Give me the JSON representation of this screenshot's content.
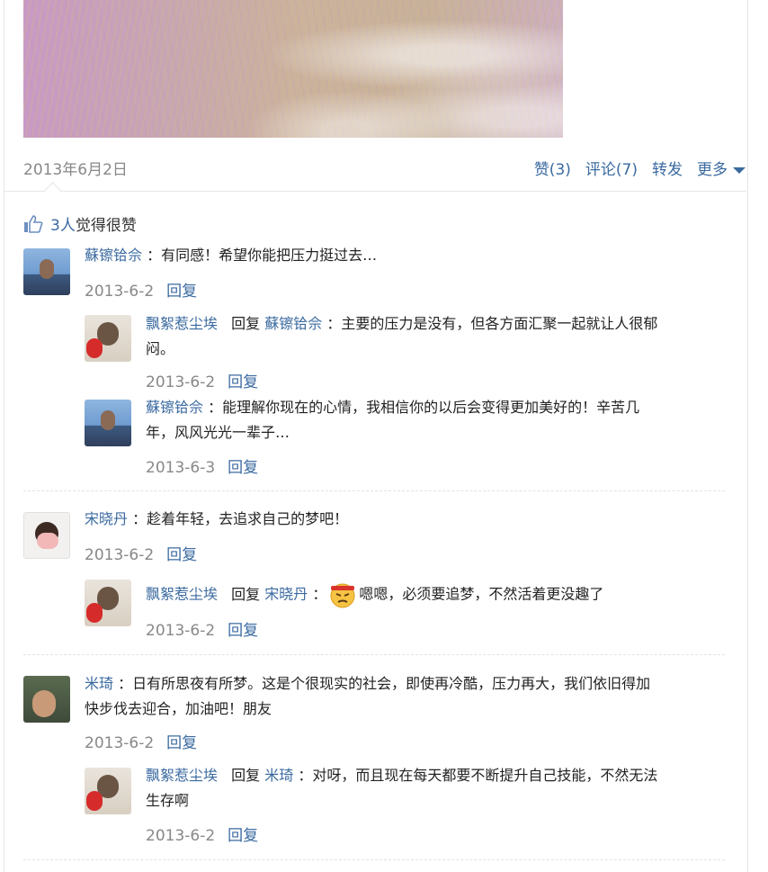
{
  "post": {
    "date": "2013年6月2日",
    "actions": {
      "like": "赞(3)",
      "comment": "评论(7)",
      "forward": "转发",
      "more": "更多"
    }
  },
  "likes": {
    "count": "3人",
    "suffix": "觉得很赞"
  },
  "reply_label": "回复",
  "comments": [
    {
      "author": "蘇镲铪佘",
      "text": "：有同感！希望你能把压力挺过去…",
      "time": "2013-6-2",
      "replies": [
        {
          "author": "飘絮惹尘埃",
          "prefix": "回复",
          "to": "蘇镲铪佘",
          "text": "：主要的压力是没有，但各方面汇聚一起就让人很郁",
          "text2": "闷。",
          "time": "2013-6-2"
        },
        {
          "author": "蘇镲铪佘",
          "text": "：能理解你现在的心情，我相信你的以后会变得更加美好的！辛苦几",
          "text2": "年，风风光光一辈子…",
          "time": "2013-6-3"
        }
      ]
    },
    {
      "author": "宋晓丹",
      "text": "：趁着年轻，去追求自己的梦吧！",
      "time": "2013-6-2",
      "replies": [
        {
          "author": "飘絮惹尘埃",
          "prefix": "回复",
          "to": "宋晓丹",
          "text": "嗯嗯，必须要追梦，不然活着更没趣了",
          "time": "2013-6-2",
          "emoji": "determined-face-icon"
        }
      ]
    },
    {
      "author": "米琦",
      "text": "：日有所思夜有所梦。这是个很现实的社会，即使再冷酷，压力再大，我们依旧得加",
      "text2": "快步伐去迎合，加油吧！朋友",
      "time": "2013-6-2",
      "replies": [
        {
          "author": "飘絮惹尘埃",
          "prefix": "回复",
          "to": "米琦",
          "text": "：对呀，而且现在每天都要不断提升自己技能，不然无法",
          "text2": "生存啊",
          "time": "2013-6-2"
        }
      ]
    }
  ]
}
